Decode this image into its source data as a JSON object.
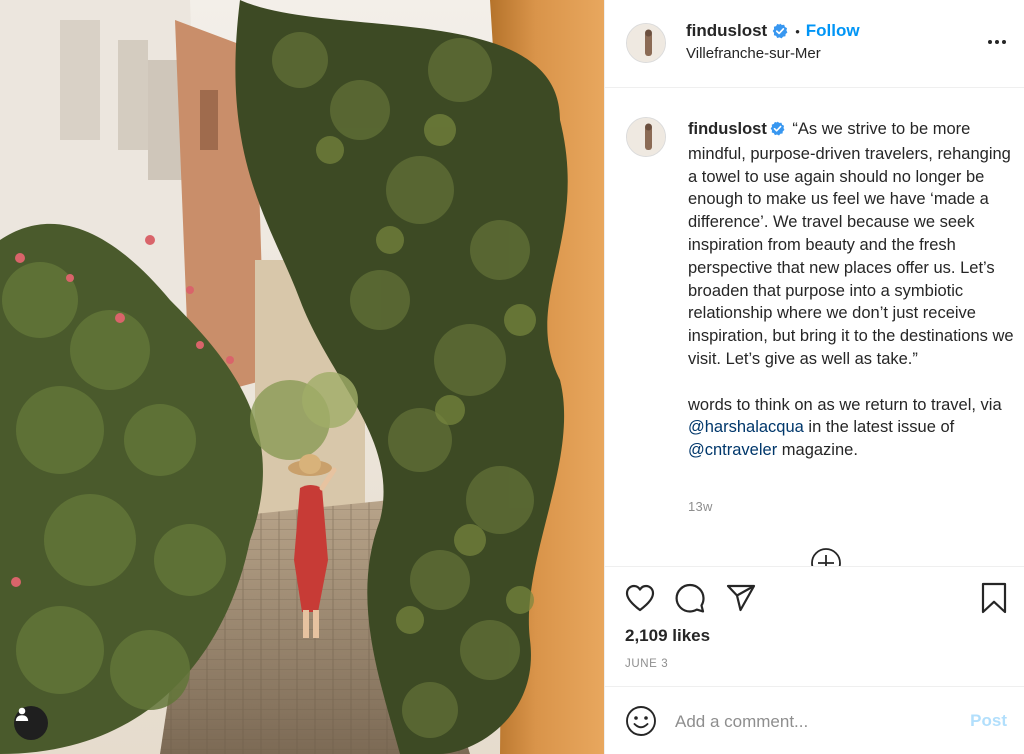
{
  "post": {
    "username": "finduslost",
    "follow_label": "Follow",
    "separator": "•",
    "location": "Villefranche-sur-Mer",
    "caption_p1": "“As we strive to be more mindful, purpose-driven travelers, rehanging a towel to use again should no longer be enough to make us feel we have ‘made a difference’. We travel because we seek inspiration from beauty and the fresh perspective that new places offer us. Let’s broaden that purpose into a symbiotic relationship where we don’t just receive inspiration, but bring it to the destinations we visit. Let’s give as well as take.”",
    "caption_p2_a": "words to think on as we return to travel, via ",
    "mention1": "@harshalacqua",
    "caption_p2_b": " in the latest issue of ",
    "mention2": "@cntraveler",
    "caption_p2_c": " magazine.",
    "timestamp": "13w",
    "likes": "2,109 likes",
    "date": "JUNE 3"
  },
  "comment": {
    "placeholder": "Add a comment...",
    "post_label": "Post"
  },
  "icons": {
    "verified": "verified-badge-icon",
    "more": "more-options-icon",
    "like": "heart-icon",
    "comment": "comment-bubble-icon",
    "share": "paper-plane-icon",
    "save": "bookmark-icon",
    "emoji": "smiley-icon",
    "tag": "user-tag-icon",
    "load_more": "plus-circle-icon"
  },
  "colors": {
    "accent": "#0095f6",
    "mention": "#00376b",
    "muted": "#8e8e8e",
    "post_disabled": "#b2dffc"
  }
}
